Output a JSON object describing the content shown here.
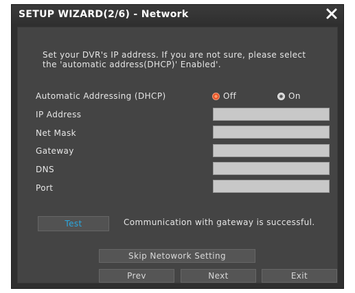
{
  "window": {
    "title": "SETUP WIZARD(2/6) - Network"
  },
  "description": {
    "line1": "Set your DVR's IP address. If you are not sure, please select",
    "line2": "the 'automatic address(DHCP)' Enabled'."
  },
  "dhcp": {
    "label": "Automatic Addressing (DHCP)",
    "options": [
      {
        "label": "Off",
        "selected": true
      },
      {
        "label": "On",
        "selected": false
      }
    ]
  },
  "fields": {
    "ip_label": "IP Address",
    "ip_value": "",
    "netmask_label": "Net Mask",
    "netmask_value": "",
    "gateway_label": "Gateway",
    "gateway_value": "",
    "dns_label": "DNS",
    "dns_value": "",
    "port_label": "Port",
    "port_value": ""
  },
  "test": {
    "button_label": "Test",
    "status_text": "Communication with gateway is successful."
  },
  "buttons": {
    "skip_label": "Skip Netowork Setting",
    "prev_label": "Prev",
    "next_label": "Next",
    "exit_label": "Exit"
  },
  "colors": {
    "accent_selected": "#e8542a",
    "test_text": "#2aa8e0"
  }
}
